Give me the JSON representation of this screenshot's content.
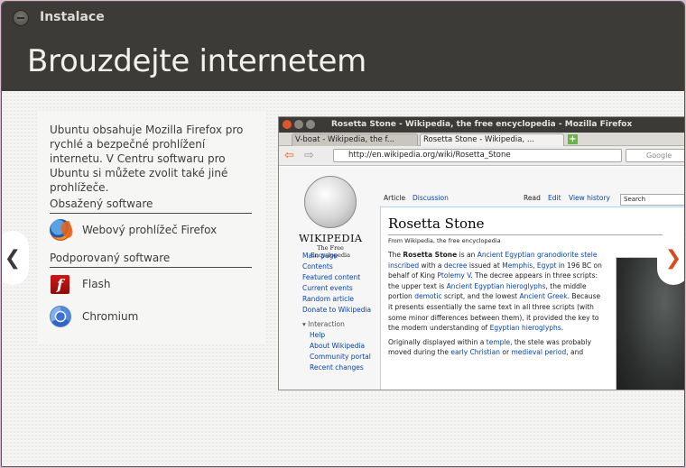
{
  "window": {
    "title": "Instalace",
    "headline": "Brouzdejte internetem"
  },
  "info": {
    "intro": "Ubuntu obsahuje Mozilla Firefox pro rychlé a bezpečné prohlížení internetu. V Centru softwaru pro Ubuntu si můžete zvolit také jiné prohlížeče.",
    "included_title": "Obsažený software",
    "included": [
      {
        "name": "Webový prohlížeč Firefox",
        "icon": "firefox-icon"
      }
    ],
    "supported_title": "Podporovaný software",
    "supported": [
      {
        "name": "Flash",
        "icon": "flash-icon"
      },
      {
        "name": "Chromium",
        "icon": "chromium-icon"
      }
    ]
  },
  "nav": {
    "prev": "❮",
    "next": "❯"
  },
  "screenshot": {
    "window_title": "Rosetta Stone - Wikipedia, the free encyclopedia - Mozilla Firefox",
    "tabs": [
      "V-boat - Wikipedia, the f...",
      "Rosetta Stone - Wikipedia, ..."
    ],
    "url": "http://en.wikipedia.org/wiki/Rosetta_Stone",
    "search_placeholder": "Google",
    "wiki": {
      "wordmark": "WIKIPEDIA",
      "tagline": "The Free Encyclopedia",
      "tabs_left": [
        "Article",
        "Discussion"
      ],
      "tabs_right": [
        "Read",
        "Edit",
        "View history"
      ],
      "search": "Search",
      "sidebar": [
        "Main page",
        "Contents",
        "Featured content",
        "Current events",
        "Random article",
        "Donate to Wikipedia"
      ],
      "interaction_title": "Interaction",
      "interaction": [
        "Help",
        "About Wikipedia",
        "Community portal",
        "Recent changes"
      ],
      "heading": "Rosetta Stone",
      "from": "From Wikipedia, the free encyclopedia"
    }
  },
  "colors": {
    "titlebar": "#3c3b37",
    "accent": "#d84d20"
  }
}
